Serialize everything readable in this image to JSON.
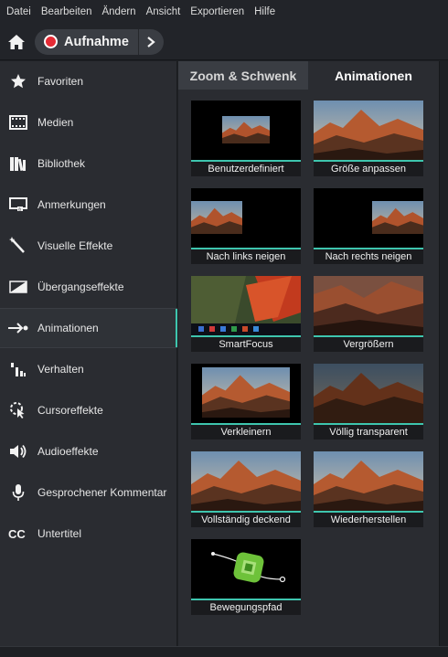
{
  "menu": [
    "Datei",
    "Bearbeiten",
    "Ändern",
    "Ansicht",
    "Exportieren",
    "Hilfe"
  ],
  "toolbar": {
    "home_icon": "home-icon",
    "record_label": "Aufnahme",
    "record_icon": "record-dot-icon",
    "expand_icon": "chevron-right-icon",
    "record_color": "#e52b35"
  },
  "sidebar": {
    "items": [
      {
        "label": "Favoriten",
        "icon": "star-icon"
      },
      {
        "label": "Medien",
        "icon": "film-strip-icon"
      },
      {
        "label": "Bibliothek",
        "icon": "books-icon"
      },
      {
        "label": "Anmerkungen",
        "icon": "callout-icon"
      },
      {
        "label": "Visuelle Effekte",
        "icon": "magic-wand-icon"
      },
      {
        "label": "Übergangseffekte",
        "icon": "transition-icon"
      },
      {
        "label": "Animationen",
        "icon": "animation-arrow-icon"
      },
      {
        "label": "Verhalten",
        "icon": "behavior-bars-icon"
      },
      {
        "label": "Cursoreffekte",
        "icon": "cursor-effect-icon"
      },
      {
        "label": "Audioeffekte",
        "icon": "speaker-icon"
      },
      {
        "label": "Gesprochener Kommentar",
        "icon": "microphone-icon"
      },
      {
        "label": "Untertitel",
        "icon": "closed-caption-icon"
      }
    ],
    "active": "Animationen",
    "accent": "#3ec5ae"
  },
  "panel": {
    "tabs": [
      {
        "label": "Zoom & Schwenk"
      },
      {
        "label": "Animationen"
      }
    ],
    "active_tab": "Animationen",
    "tiles": [
      {
        "label": "Benutzerdefiniert"
      },
      {
        "label": "Größe anpassen"
      },
      {
        "label": "Nach links neigen"
      },
      {
        "label": "Nach rechts neigen"
      },
      {
        "label": "SmartFocus"
      },
      {
        "label": "Vergrößern"
      },
      {
        "label": "Verkleinern"
      },
      {
        "label": "Völlig transparent"
      },
      {
        "label": "Vollständig deckend"
      },
      {
        "label": "Wiederherstellen"
      },
      {
        "label": "Bewegungspfad"
      }
    ]
  }
}
